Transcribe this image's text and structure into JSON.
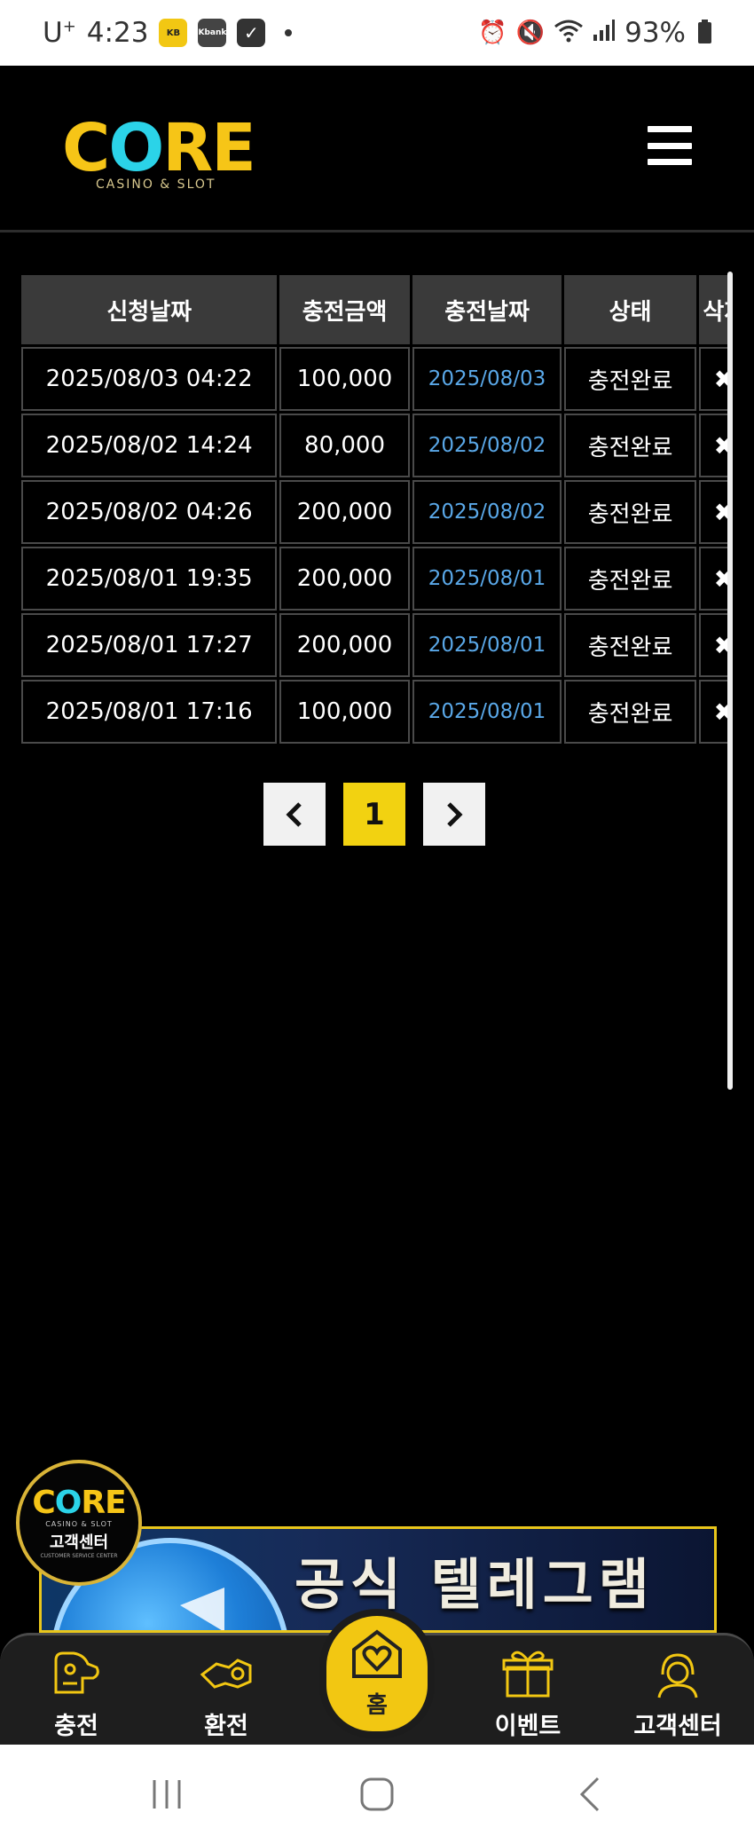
{
  "status_bar": {
    "carrier": "U",
    "carrier_sup": "+",
    "time": "4:23",
    "app_icons": [
      "kb-icon",
      "kbank-icon",
      "check-icon"
    ],
    "kb_label": "KB",
    "kbank_label": "Kbank",
    "check_label": "✓",
    "battery": "93%"
  },
  "header": {
    "logo_main_a": "C",
    "logo_main_o": "O",
    "logo_main_b": "RE",
    "logo_sub": "CASINO & SLOT"
  },
  "table": {
    "headers": [
      "신청날짜",
      "충전금액",
      "충전날짜",
      "상태",
      "삭제"
    ],
    "rows": [
      {
        "applied": "2025/08/03 04:22",
        "amount": "100,000",
        "date": "2025/08/03",
        "status": "충전완료",
        "delete": "✖"
      },
      {
        "applied": "2025/08/02 14:24",
        "amount": "80,000",
        "date": "2025/08/02",
        "status": "충전완료",
        "delete": "✖"
      },
      {
        "applied": "2025/08/02 04:26",
        "amount": "200,000",
        "date": "2025/08/02",
        "status": "충전완료",
        "delete": "✖"
      },
      {
        "applied": "2025/08/01 19:35",
        "amount": "200,000",
        "date": "2025/08/01",
        "status": "충전완료",
        "delete": "✖"
      },
      {
        "applied": "2025/08/01 17:27",
        "amount": "200,000",
        "date": "2025/08/01",
        "status": "충전완료",
        "delete": "✖"
      },
      {
        "applied": "2025/08/01 17:16",
        "amount": "100,000",
        "date": "2025/08/01",
        "status": "충전완료",
        "delete": "✖"
      }
    ]
  },
  "pagination": {
    "prev": "‹",
    "current": "1",
    "next": "›"
  },
  "banner": {
    "text": "공식 텔레그램"
  },
  "cs_badge": {
    "logo_a": "C",
    "logo_o": "O",
    "logo_b": "RE",
    "sub": "CASINO & SLOT",
    "title": "고객센터",
    "tiny": "CUSTOMER SERVICE CENTER"
  },
  "bottom_nav": {
    "items": [
      {
        "label": "충전",
        "icon": "deposit-icon"
      },
      {
        "label": "환전",
        "icon": "withdraw-icon"
      },
      {
        "label": "홈",
        "icon": "home-heart-icon"
      },
      {
        "label": "이벤트",
        "icon": "gift-icon"
      },
      {
        "label": "고객센터",
        "icon": "support-icon"
      }
    ]
  },
  "colors": {
    "accent_yellow": "#f2c712",
    "date_blue": "#5aa8e8",
    "logo_cyan": "#2bd3e8"
  }
}
